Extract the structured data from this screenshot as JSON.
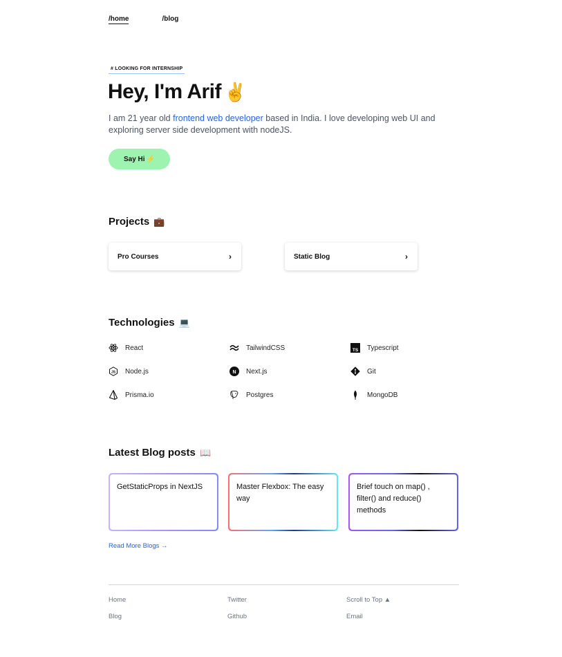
{
  "nav": {
    "home": "/home",
    "blog": "/blog"
  },
  "hero": {
    "badge": "# LOOKING FOR INTERNSHIP",
    "title": "Hey, I'm Arif",
    "title_emoji": "✌️",
    "intro_before": "I am 21 year old ",
    "intro_highlight": "frontend web developer",
    "intro_after": " based in India. I love developing web UI and exploring server side development with nodeJS.",
    "button_label": "Say Hi",
    "button_emoji": "⚡"
  },
  "projects": {
    "heading": "Projects",
    "heading_emoji": "💼",
    "items": [
      {
        "label": "Pro Courses"
      },
      {
        "label": "Static Blog"
      }
    ]
  },
  "technologies": {
    "heading": "Technologies",
    "heading_emoji": "💻",
    "items": [
      {
        "label": "React",
        "icon": "react-icon"
      },
      {
        "label": "TailwindCSS",
        "icon": "tailwind-icon"
      },
      {
        "label": "Typescript",
        "icon": "typescript-icon"
      },
      {
        "label": "Node.js",
        "icon": "nodejs-icon"
      },
      {
        "label": "Next.js",
        "icon": "nextjs-icon"
      },
      {
        "label": "Git",
        "icon": "git-icon"
      },
      {
        "label": "Prisma.io",
        "icon": "prisma-icon"
      },
      {
        "label": "Postgres",
        "icon": "postgres-icon"
      },
      {
        "label": "MongoDB",
        "icon": "mongodb-icon"
      }
    ]
  },
  "blog": {
    "heading": "Latest Blog posts",
    "heading_emoji": "📖",
    "posts": [
      {
        "title": "GetStaticProps in NextJS"
      },
      {
        "title": "Master Flexbox: The easy way"
      },
      {
        "title": "Brief touch on map() , filter() and reduce() methods"
      }
    ],
    "read_more": "Read More Blogs →"
  },
  "footer": {
    "col1": [
      "Home",
      "Blog"
    ],
    "col2": [
      "Twitter",
      "Github"
    ],
    "col3": [
      "Scroll to Top ▲",
      "Email"
    ]
  },
  "colors": {
    "accent": "#2563eb",
    "button_bg": "#9ff3b0"
  }
}
